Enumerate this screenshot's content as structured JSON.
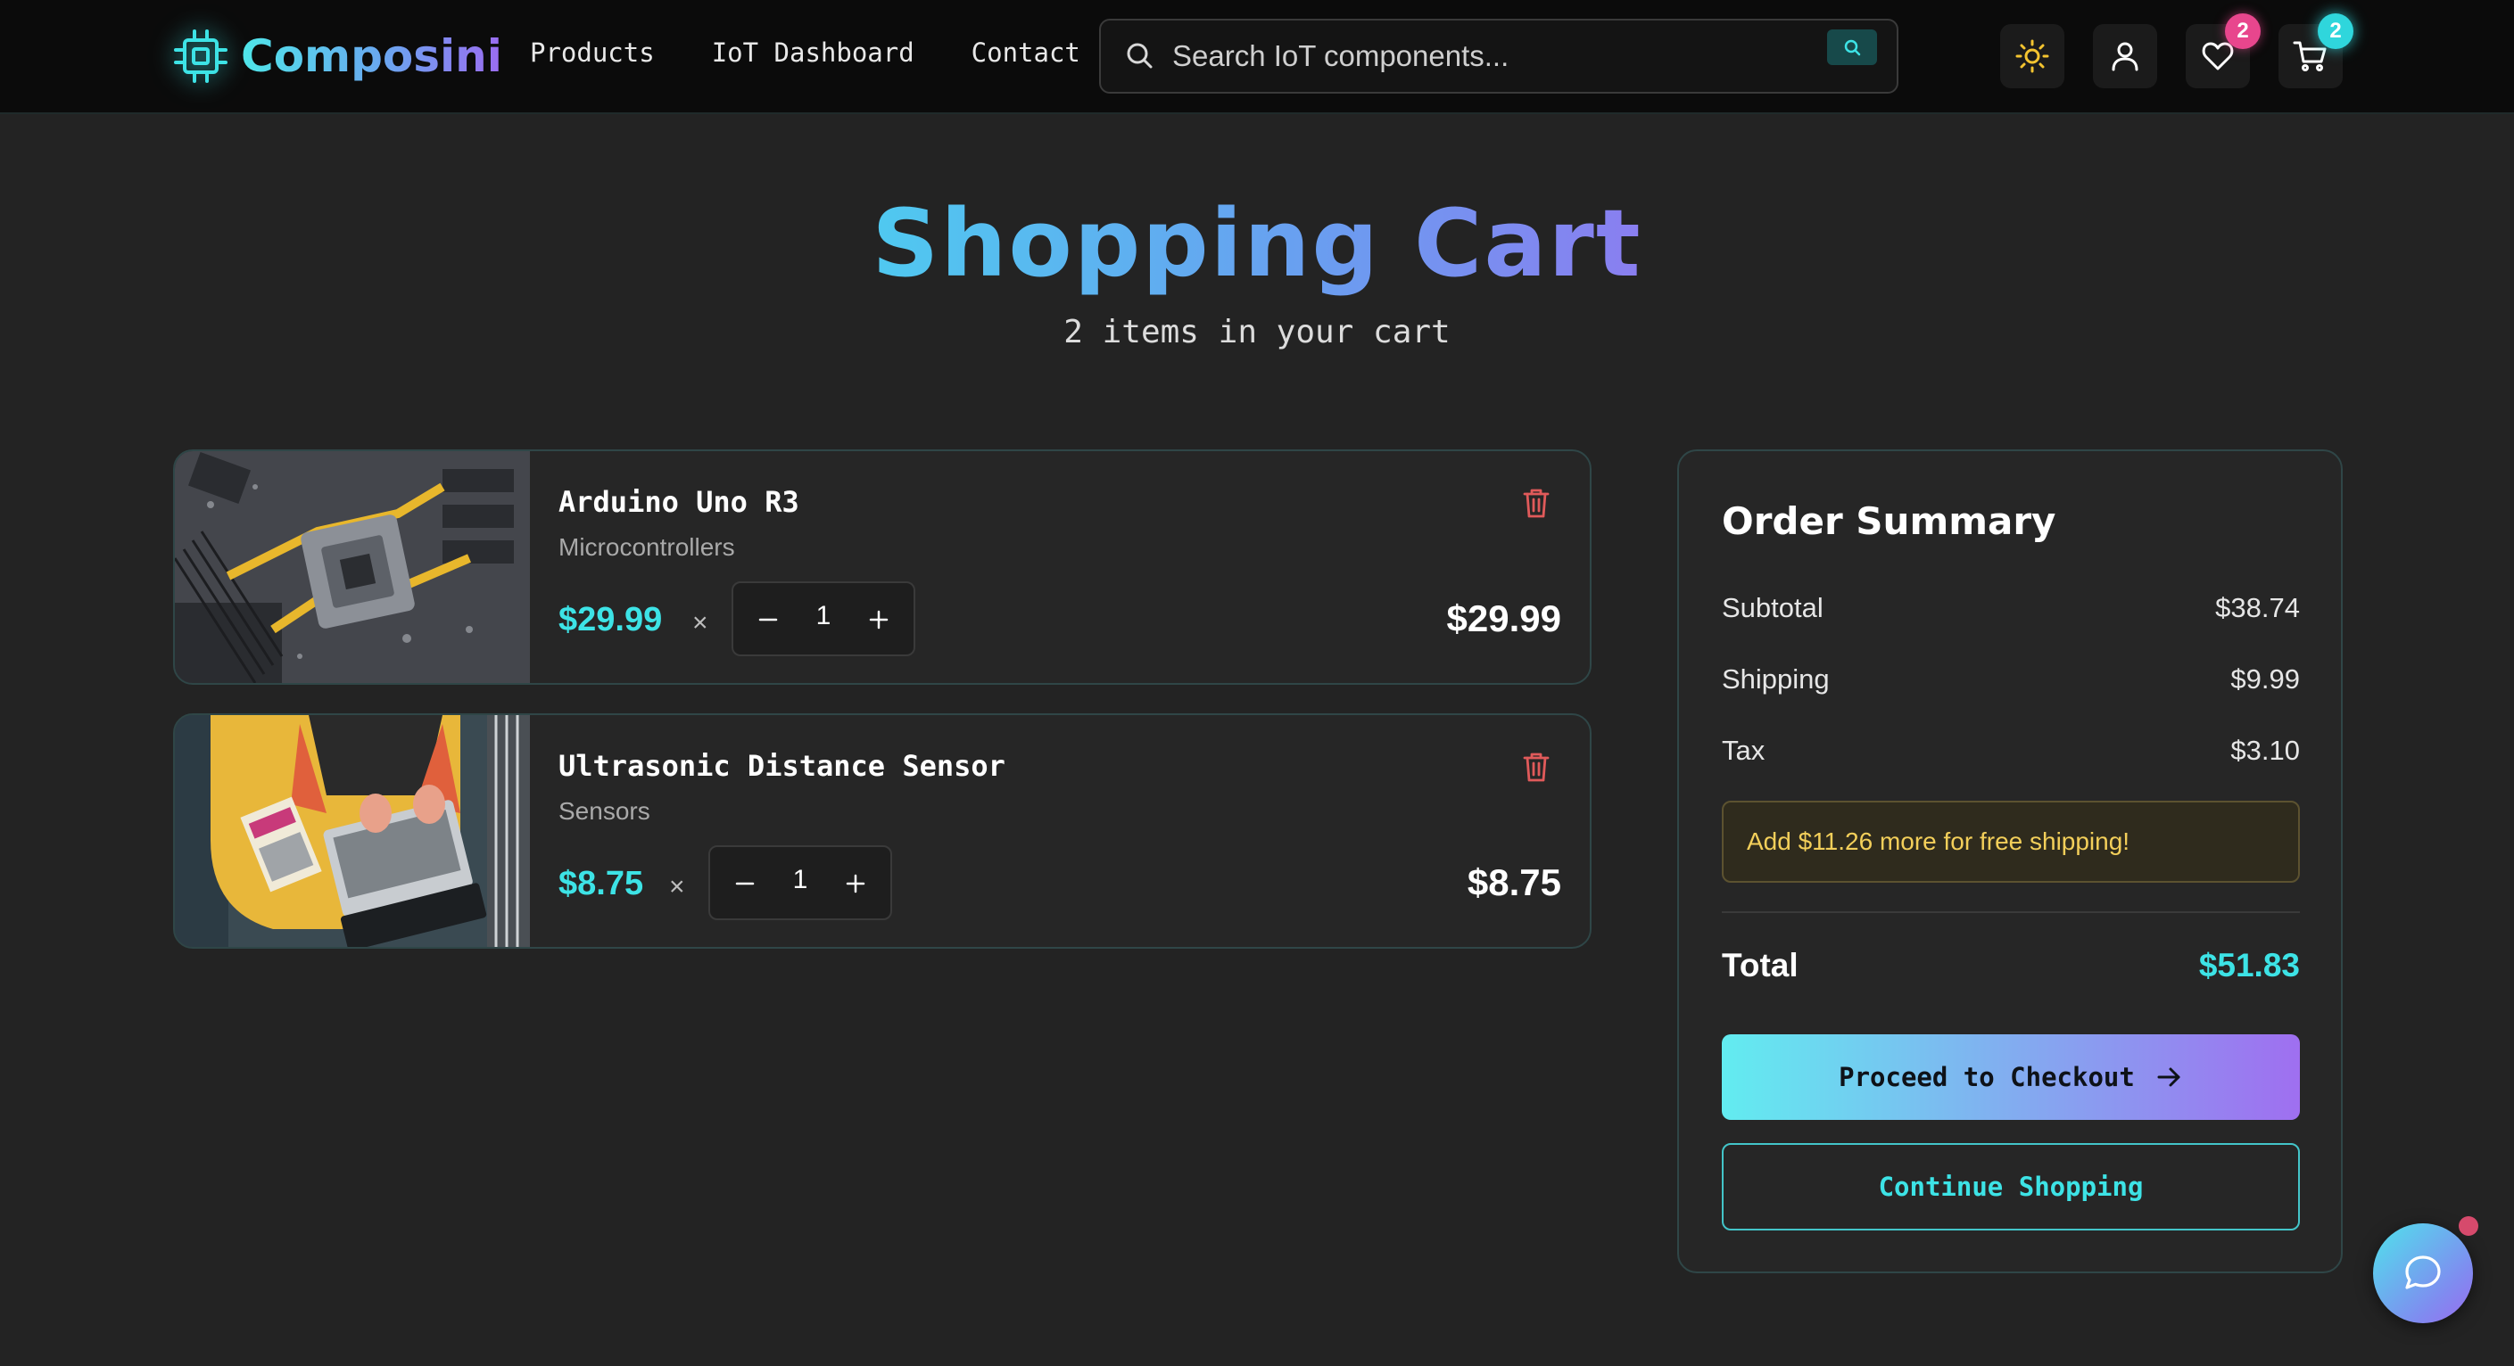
{
  "colors": {
    "accent_cyan": "#3de3e6",
    "accent_purple": "#9b6cf0",
    "background": "#232323",
    "navbar": "#0b0b0b",
    "warning_text": "#f3cf5a",
    "trash_red": "#e05a5a"
  },
  "nav": {
    "brand": "Composini",
    "brand_icon": "chip-icon",
    "links": [
      "Products",
      "IoT Dashboard",
      "Contact"
    ],
    "search": {
      "placeholder": "Search IoT components...",
      "value": ""
    },
    "theme_icon": "sun-icon",
    "user_icon": "user-icon",
    "wishlist": {
      "icon": "heart-icon",
      "count": "2"
    },
    "cart": {
      "icon": "cart-icon",
      "count": "2"
    }
  },
  "page": {
    "title": "Shopping Cart",
    "subtitle": "2 items in your cart"
  },
  "cart": {
    "items": [
      {
        "name": "Arduino Uno R3",
        "category": "Microcontrollers",
        "price": "$29.99",
        "times": "×",
        "quantity": "1",
        "total": "$29.99",
        "image": "circuit-board-photo"
      },
      {
        "name": "Ultrasonic Distance Sensor",
        "category": "Sensors",
        "price": "$8.75",
        "times": "×",
        "quantity": "1",
        "total": "$8.75",
        "image": "laptop-person-photo"
      }
    ]
  },
  "summary": {
    "title": "Order Summary",
    "rows": [
      {
        "label": "Subtotal",
        "value": "$38.74"
      },
      {
        "label": "Shipping",
        "value": "$9.99"
      },
      {
        "label": "Tax",
        "value": "$3.10"
      }
    ],
    "notice": "Add $11.26 more for free shipping!",
    "total_label": "Total",
    "total_value": "$51.83",
    "checkout_label": "Proceed to Checkout",
    "continue_label": "Continue Shopping"
  },
  "chat": {
    "icon": "chat-bubble-icon"
  }
}
